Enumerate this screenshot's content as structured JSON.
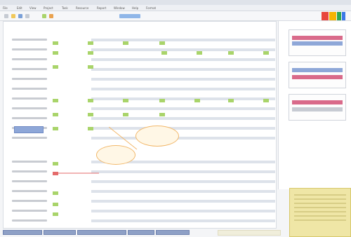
{
  "menu": [
    "File",
    "Edit",
    "View",
    "Project",
    "Task",
    "Resource",
    "Report",
    "Window",
    "Help",
    "Format"
  ],
  "toolbar": {
    "icons": [
      "new-icon",
      "open-icon",
      "save-icon",
      "print-icon",
      "undo-icon",
      "redo-icon",
      "zoom-icon"
    ]
  },
  "main": {
    "heading": "",
    "button_label": ""
  },
  "callouts": {
    "first": "",
    "second": ""
  },
  "tabs": [
    "",
    "",
    "",
    "",
    ""
  ],
  "colors": {
    "green": "#a9d46a",
    "red": "#e46b6b",
    "accent": "#8ea7d8",
    "note": "#efe6a6"
  }
}
